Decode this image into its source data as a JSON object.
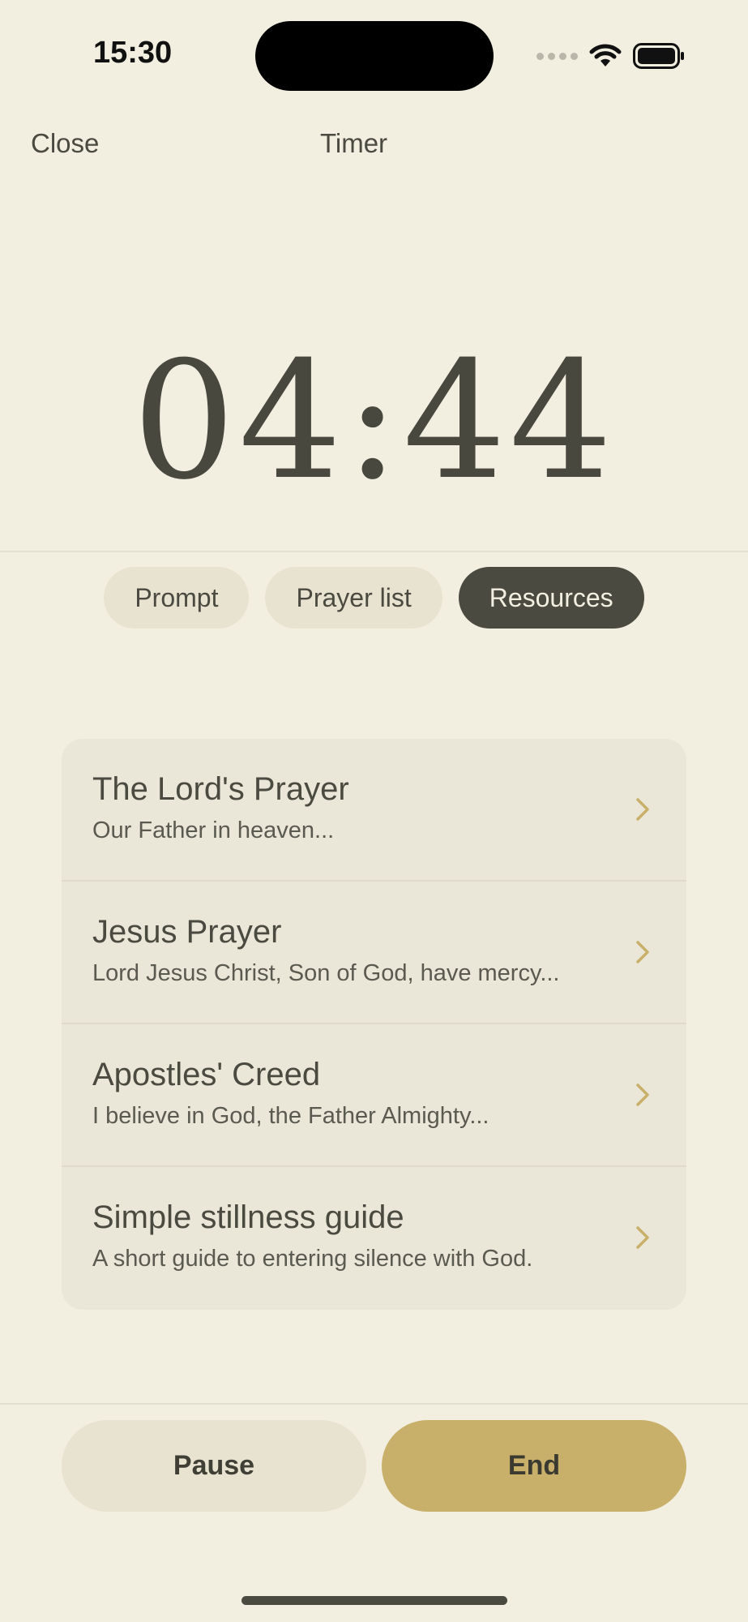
{
  "status_bar": {
    "time": "15:30"
  },
  "nav": {
    "close_label": "Close",
    "title": "Timer"
  },
  "timer": {
    "display": "04:44"
  },
  "tabs": [
    {
      "label": "Prompt",
      "active": false
    },
    {
      "label": "Prayer list",
      "active": false
    },
    {
      "label": "Resources",
      "active": true
    }
  ],
  "resources": [
    {
      "title": "The Lord's Prayer",
      "subtitle": "Our Father in heaven..."
    },
    {
      "title": "Jesus Prayer",
      "subtitle": "Lord Jesus Christ, Son of God, have mercy..."
    },
    {
      "title": "Apostles' Creed",
      "subtitle": "I believe in God, the Father Almighty..."
    },
    {
      "title": "Simple stillness guide",
      "subtitle": "A short guide to entering silence with God."
    }
  ],
  "actions": {
    "pause_label": "Pause",
    "end_label": "End"
  },
  "colors": {
    "background": "#f2efe1",
    "accent": "#c9b06a",
    "dark": "#4a4a40"
  },
  "icons": {
    "row_chevron": "chevron-right-icon"
  }
}
